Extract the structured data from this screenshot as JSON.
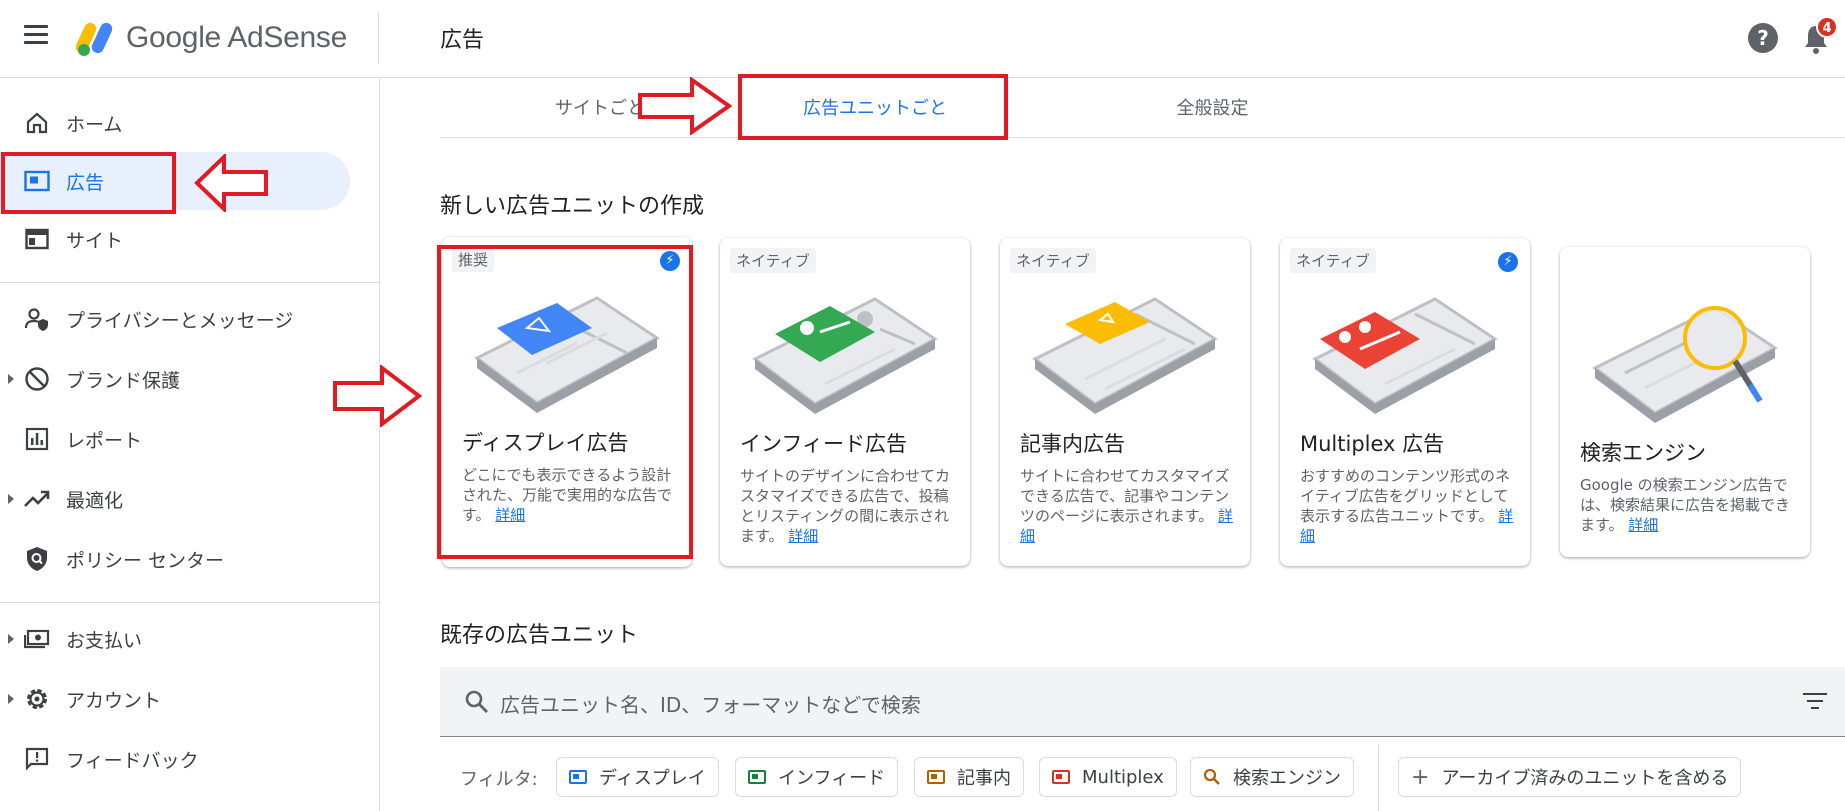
{
  "app": {
    "logo_text": "Google AdSense",
    "page_title": "広告",
    "notification_count": "4",
    "help_glyph": "?"
  },
  "sidebar": {
    "items": [
      {
        "label": "ホーム",
        "icon": "home-icon"
      },
      {
        "label": "広告",
        "icon": "ads-icon",
        "active": true
      },
      {
        "label": "サイト",
        "icon": "sites-icon"
      },
      {
        "label": "プライバシーとメッセージ",
        "icon": "privacy-icon"
      },
      {
        "label": "ブランド保護",
        "icon": "block-icon"
      },
      {
        "label": "レポート",
        "icon": "report-icon"
      },
      {
        "label": "最適化",
        "icon": "trending-icon"
      },
      {
        "label": "ポリシー センター",
        "icon": "policy-icon"
      },
      {
        "label": "お支払い",
        "icon": "payments-icon"
      },
      {
        "label": "アカウント",
        "icon": "gear-icon"
      },
      {
        "label": "フィードバック",
        "icon": "feedback-icon"
      }
    ]
  },
  "tabs": [
    {
      "label": "サイトごと"
    },
    {
      "label": "広告ユニットごと",
      "active": true
    },
    {
      "label": "全般設定"
    }
  ],
  "create_section": {
    "title": "新しい広告ユニットの作成",
    "cards": [
      {
        "tag": "推奨",
        "bolt": true,
        "title": "ディスプレイ広告",
        "desc": "どこにでも表示できるよう設計された、万能で実用的な広告です。",
        "link": "詳細",
        "color": "#4285f4"
      },
      {
        "tag": "ネイティブ",
        "bolt": false,
        "title": "インフィード広告",
        "desc": "サイトのデザインに合わせてカスタマイズできる広告で、投稿とリスティングの間に表示されます。",
        "link": "詳細",
        "color": "#34a853"
      },
      {
        "tag": "ネイティブ",
        "bolt": false,
        "title": "記事内広告",
        "desc": "サイトに合わせてカスタマイズできる広告で、記事やコンテンツのページに表示されます。",
        "link": "詳細",
        "color": "#fbbc04"
      },
      {
        "tag": "ネイティブ",
        "bolt": true,
        "title": "Multiplex 広告",
        "desc": "おすすめのコンテンツ形式のネイティブ広告をグリッドとして表示する広告ユニットです。",
        "link": "詳細",
        "color": "#ea4335"
      },
      {
        "tag": "",
        "bolt": false,
        "title": "検索エンジン",
        "desc": "Google の検索エンジン広告では、検索結果に広告を掲載できます。",
        "link": "詳細",
        "color": "#fbbc04"
      }
    ]
  },
  "existing_section": {
    "title": "既存の広告ユニット",
    "search_placeholder": "広告ユニット名、ID、フォーマットなどで検索",
    "filter_label": "フィルタ:",
    "chips": [
      {
        "label": "ディスプレイ",
        "color": "#1a73e8"
      },
      {
        "label": "インフィード",
        "color": "#188038"
      },
      {
        "label": "記事内",
        "color": "#b06000"
      },
      {
        "label": "Multiplex",
        "color": "#d93025"
      },
      {
        "label": "検索エンジン",
        "color": "#b06000"
      }
    ],
    "archive_label": "アーカイブ済みのユニットを含める"
  },
  "annotation_color": "#e01b24"
}
